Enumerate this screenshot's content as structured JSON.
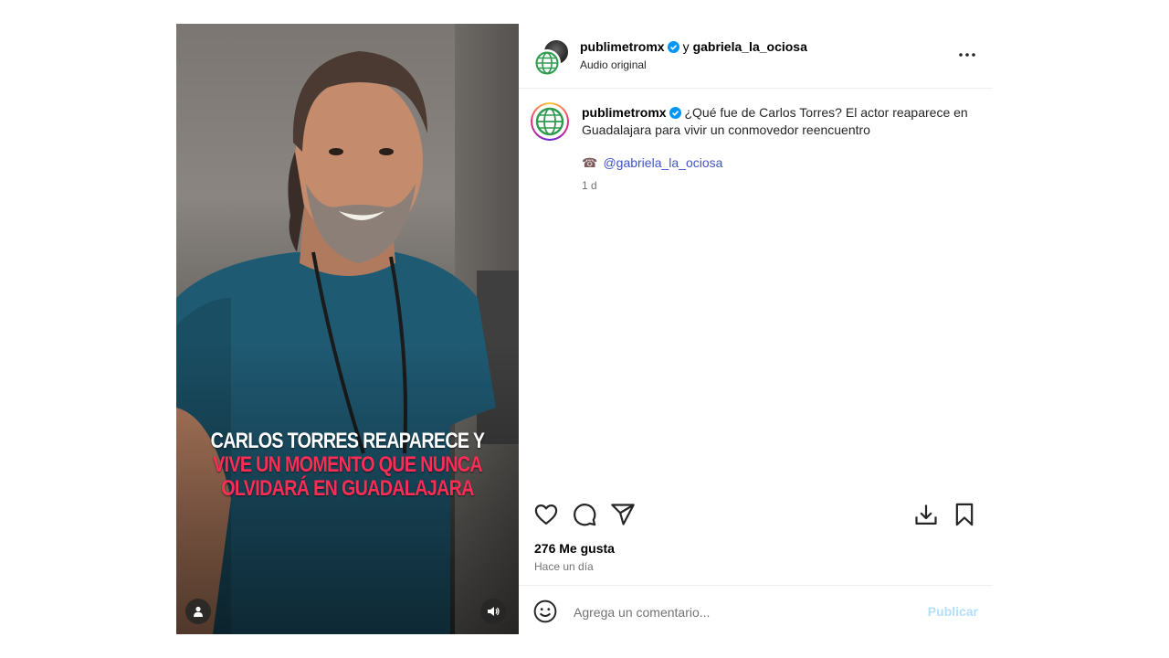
{
  "media": {
    "overlay_line1": "CARLOS TORRES REAPARECE Y",
    "overlay_line2": "VIVE UN MOMENTO QUE NUNCA",
    "overlay_line3": "OLVIDARÁ EN GUADALAJARA",
    "overlay_colors": {
      "white": "#ffffff",
      "red": "#ff2d55"
    },
    "tag_icon": "user-tag-icon",
    "audio_icon": "speaker-icon"
  },
  "header": {
    "author": "publimetromx",
    "connector": "y",
    "coauthor": "gabriela_la_ociosa",
    "audio": "Audio original",
    "more_icon": "more-options-icon"
  },
  "caption": {
    "user": "publimetromx",
    "text": "¿Qué fue de Carlos Torres? El actor reaparece en Guadalajara para vivir un conmovedor reencuentro",
    "mention_emoji": "☎",
    "mention": "@gabriela_la_ociosa",
    "time": "1 d"
  },
  "actions": {
    "like_icon": "heart-icon",
    "comment_icon": "comment-icon",
    "share_icon": "send-icon",
    "download_icon": "download-icon",
    "save_icon": "bookmark-icon"
  },
  "stats": {
    "likes": "276 Me gusta",
    "age": "Hace un día"
  },
  "comment": {
    "placeholder": "Agrega un comentario...",
    "publish": "Publicar"
  },
  "colors": {
    "verified": "#0095f6",
    "link": "#4154c4",
    "publish_disabled": "#b2dffc",
    "globe": "#2e9b4f"
  }
}
